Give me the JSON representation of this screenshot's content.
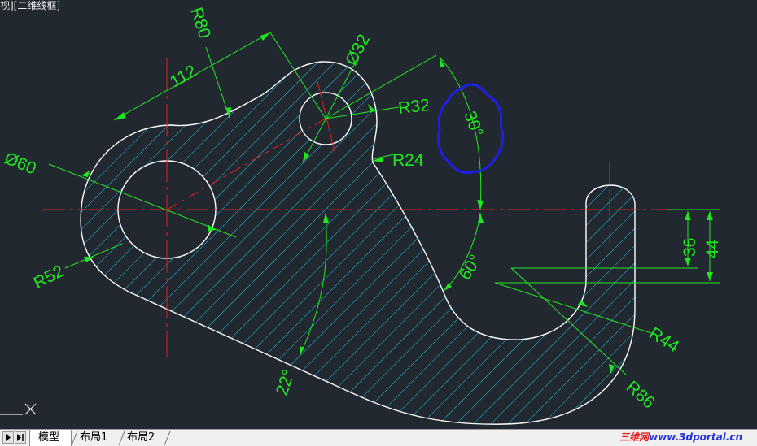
{
  "window": {
    "viewport_label": "视][二维线框]"
  },
  "colors": {
    "background": "#212830",
    "outline": "#ffffff",
    "hatch": "#22c8e8",
    "dimension": "#20e820",
    "centerline": "#e02020",
    "annotation": "#1e1ee6"
  },
  "drawing": {
    "dimensions": {
      "r80": "R80",
      "d112": "112",
      "d32": "Ø32",
      "r32": "R32",
      "r24": "R24",
      "a30": "30°",
      "d60": "Ø60",
      "r52": "R52",
      "a60": "60°",
      "a22": "22°",
      "d36": "36",
      "d44": "44",
      "r44": "R44",
      "r86": "R86"
    }
  },
  "tabs": {
    "items": [
      {
        "label": "模型",
        "active": true
      },
      {
        "label": "布局1",
        "active": false
      },
      {
        "label": "布局2",
        "active": false
      }
    ]
  },
  "watermark": {
    "prefix": "三维网",
    "url": "www.3dportal.cn"
  }
}
